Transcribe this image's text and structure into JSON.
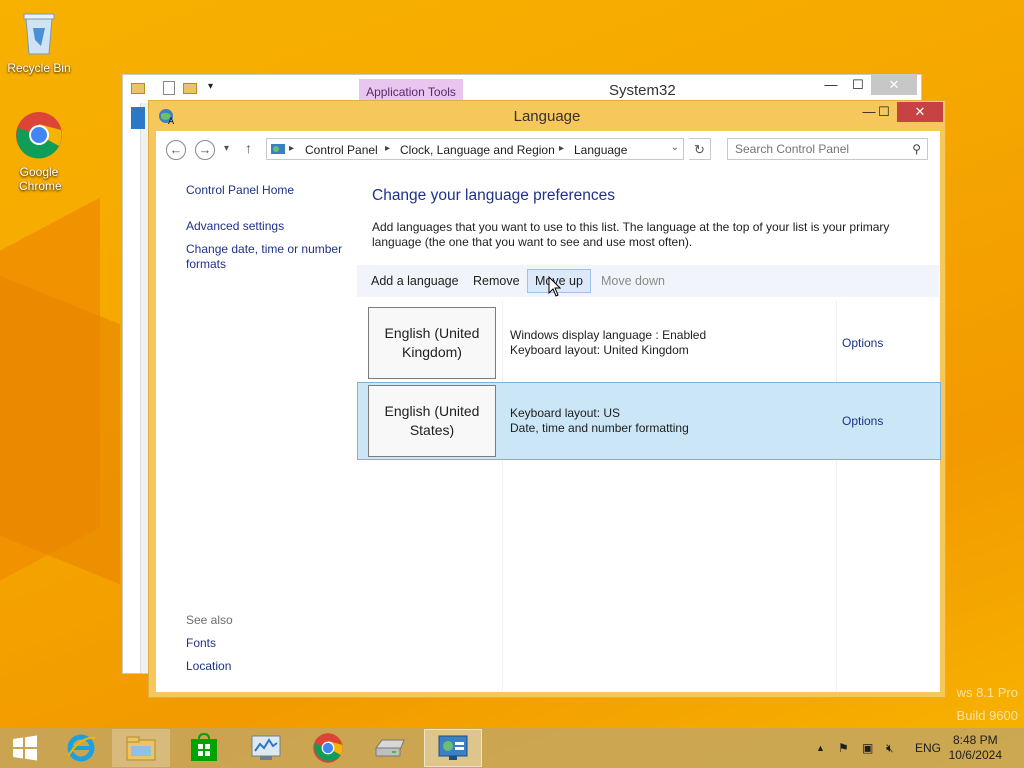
{
  "desktop": {
    "icons": [
      {
        "label": "Recycle Bin",
        "icon": "recycle-bin-icon"
      },
      {
        "label": "Google Chrome",
        "icon": "chrome-icon"
      }
    ],
    "watermark": {
      "line1": "ws 8.1 Pro",
      "line2": "Build 9600"
    }
  },
  "back_window": {
    "ribbon_tab": "Application Tools",
    "title": "System32"
  },
  "window": {
    "title": "Language",
    "controls": {
      "minimize": "—",
      "maximize": "☐",
      "close": "✕"
    }
  },
  "address_bar": {
    "breadcrumbs": [
      "Control Panel",
      "Clock, Language and Region",
      "Language"
    ],
    "search_placeholder": "Search Control Panel"
  },
  "left_nav": {
    "home": "Control Panel Home",
    "links": [
      "Advanced settings",
      "Change date, time or number formats"
    ],
    "see_also_title": "See also",
    "see_also": [
      "Fonts",
      "Location"
    ]
  },
  "main": {
    "heading": "Change your language preferences",
    "description": "Add languages that you want to use to this list. The language at the top of your list is your primary language (the one that you want to see and use most often).",
    "toolbar": {
      "add": "Add a language",
      "remove": "Remove",
      "move_up": "Move up",
      "move_down": "Move down"
    },
    "languages": [
      {
        "name": "English (United Kingdom)",
        "line1": "Windows display language : Enabled",
        "line2": "Keyboard layout: United Kingdom",
        "options": "Options",
        "selected": false
      },
      {
        "name": "English (United States)",
        "line1": "Keyboard layout: US",
        "line2": "Date, time and number formatting",
        "options": "Options",
        "selected": true
      }
    ]
  },
  "taskbar": {
    "apps": [
      "start-icon",
      "internet-explorer-icon",
      "file-explorer-icon",
      "store-icon",
      "task-manager-icon",
      "chrome-icon",
      "hard-drive-icon",
      "control-panel-icon"
    ],
    "tray": {
      "language": "ENG",
      "time": "8:48 PM",
      "date": "10/6/2024"
    }
  },
  "colors": {
    "desktop_bg": "#f5a700",
    "window_frame": "#f6c75a",
    "link": "#1e3287",
    "selection": "#cbe6f6",
    "close_button": "#c74343"
  }
}
